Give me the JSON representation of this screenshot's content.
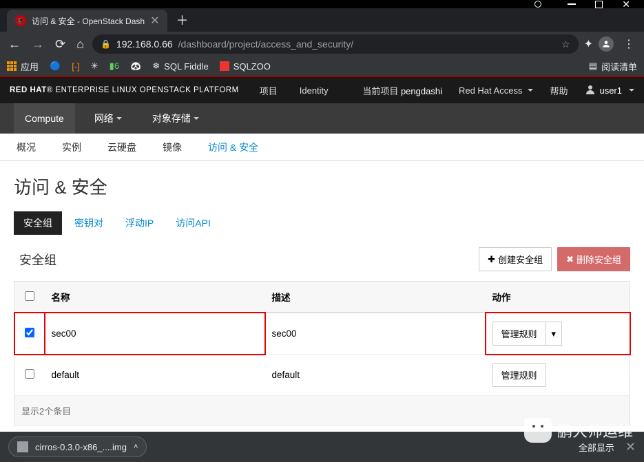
{
  "browser": {
    "tab_title": "访问 & 安全 - OpenStack Dash",
    "url_host": "192.168.0.66",
    "url_path": "/dashboard/project/access_and_security/",
    "bookmarks_label": "应用",
    "bookmark_items": [
      "",
      "",
      "",
      "",
      "",
      "SQL Fiddle",
      "SQLZOO"
    ],
    "reading_list": "阅读清单"
  },
  "os": {
    "brand_bold": "RED HAT",
    "brand_rest": "ENTERPRISE LINUX OPENSTACK PLATFORM",
    "nav": [
      "项目",
      "Identity"
    ],
    "current_project_label": "当前项目",
    "current_project": "pengdashi",
    "access_link": "Red Hat Access",
    "help": "帮助",
    "user": "user1",
    "subnav": [
      "Compute",
      "网络",
      "对象存储"
    ],
    "subnav_active": 0,
    "tabs": [
      "概况",
      "实例",
      "云硬盘",
      "镜像",
      "访问 & 安全"
    ],
    "tabs_active": 4
  },
  "page": {
    "title": "访问 & 安全",
    "subtabs": [
      "安全组",
      "密钥对",
      "浮动IP",
      "访问API"
    ],
    "subtabs_active": 0,
    "section_title": "安全组",
    "create_btn": "创建安全组",
    "delete_btn": "删除安全组",
    "columns": {
      "name": "名称",
      "desc": "描述",
      "action": "动作"
    },
    "rows": [
      {
        "checked": true,
        "name": "sec00",
        "desc": "sec00",
        "action": "管理规则",
        "has_dropdown": true
      },
      {
        "checked": false,
        "name": "default",
        "desc": "default",
        "action": "管理规则",
        "has_dropdown": false
      }
    ],
    "footer": "显示2个条目"
  },
  "download": {
    "filename": "cirros-0.3.0-x86_....img",
    "show_all": "全部显示"
  },
  "watermark": "鹏大师运维"
}
